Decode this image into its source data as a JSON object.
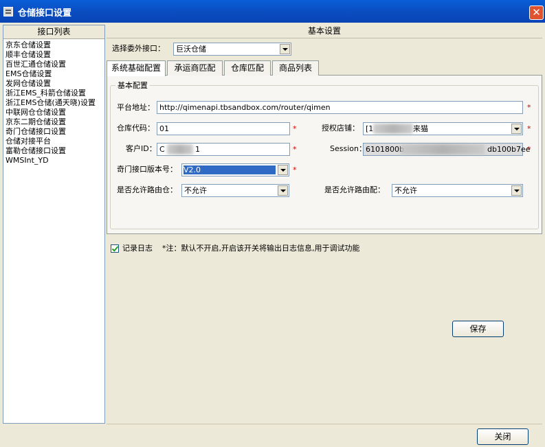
{
  "window": {
    "title": "仓储接口设置",
    "close_glyph": "✕"
  },
  "sidebar": {
    "header": "接口列表",
    "items": [
      "京东仓储设置",
      "顺丰仓储设置",
      "百世汇通仓储设置",
      "EMS仓储设置",
      "发网仓储设置",
      "浙江EMS_科箭仓储设置",
      "浙江EMS仓储(通天晓)设置",
      "中联网仓仓储设置",
      "京东二期仓储设置",
      "奇门仓储接口设置",
      "仓储对接平台",
      "富勒仓储接口设置",
      "WMSInt_YD"
    ]
  },
  "main": {
    "header": "基本设置",
    "select_label": "选择委外接口：",
    "select_value": "巨沃仓储",
    "tabs": [
      "系统基础配置",
      "承运商匹配",
      "仓库匹配",
      "商品列表"
    ],
    "group_title": "基本配置",
    "platform_label": "平台地址：",
    "platform_value": "http://qimenapi.tbsandbox.com/router/qimen",
    "warehouse_label": "仓库代码：",
    "warehouse_value": "01",
    "store_label": "授权店铺：",
    "store_value_pre": "[1",
    "store_value_post": "来猫",
    "customer_label": "客户ID：",
    "customer_value_pre": "C",
    "customer_value_post": "1",
    "session_label": "Session：",
    "session_value_pre": "6101800b",
    "session_value_post": "db100b7ee",
    "version_label": "奇门接口版本号：",
    "version_value": "V2.0",
    "route_warehouse_label": "是否允许路由仓：",
    "route_warehouse_value": "不允许",
    "route_match_label": "是否允许路由配：",
    "route_match_value": "不允许",
    "required_mark": "*"
  },
  "log": {
    "label": "记录日志",
    "note": "*注：默认不开启,开启该开关将输出日志信息,用于调试功能",
    "checked": true
  },
  "buttons": {
    "save": "保存",
    "close": "关闭"
  },
  "colors": {
    "title_bar": "#0b4fc4",
    "required": "#d00000",
    "selection": "#316ac5"
  }
}
